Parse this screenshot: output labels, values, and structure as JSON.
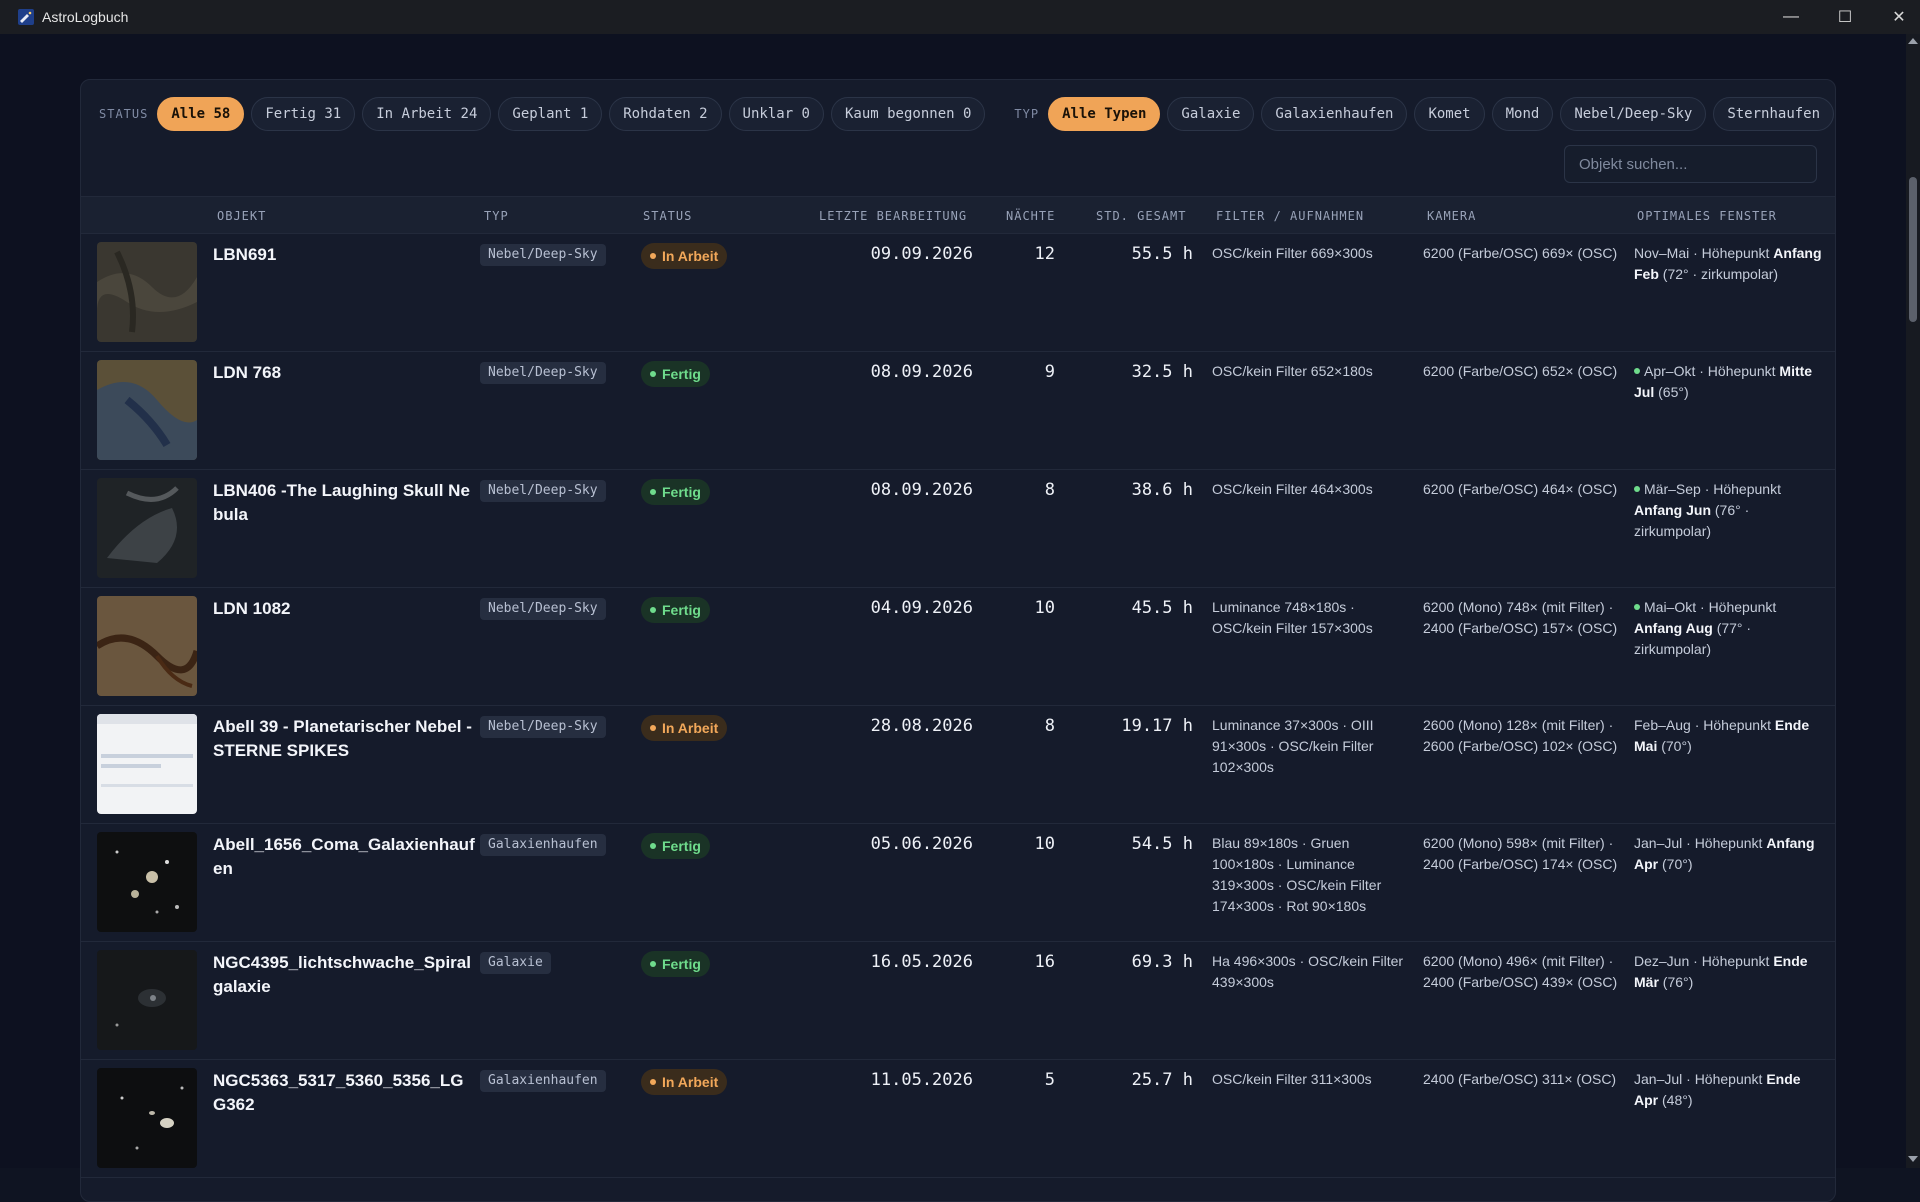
{
  "window": {
    "title": "AstroLogbuch",
    "minimize_glyph": "—",
    "maximize_glyph": "☐",
    "close_glyph": "✕"
  },
  "status_filter": {
    "label": "STATUS",
    "chips": [
      "Alle 58",
      "Fertig 31",
      "In Arbeit 24",
      "Geplant 1",
      "Rohdaten 2",
      "Unklar 0",
      "Kaum begonnen 0"
    ],
    "active": "Alle 58"
  },
  "type_filter": {
    "label": "TYP",
    "chips": [
      "Alle Typen",
      "Galaxie",
      "Galaxienhaufen",
      "Komet",
      "Mond",
      "Nebel/Deep-Sky",
      "Sternhaufen"
    ],
    "active": "Alle Typen"
  },
  "search": {
    "placeholder": "Objekt suchen..."
  },
  "table": {
    "headers": {
      "objekt": "OBJEKT",
      "typ": "TYP",
      "status": "STATUS",
      "letzte": "LETZTE BEARBEITUNG",
      "naechte": "NÄCHTE",
      "std": "STD. GESAMT",
      "filter": "FILTER / AUFNAHMEN",
      "kamera": "KAMERA",
      "fenster": "OPTIMALES FENSTER"
    },
    "rows": [
      {
        "objekt": "LBN691",
        "typ": "Nebel/Deep-Sky",
        "status": "In Arbeit",
        "datum": "09.09.2026",
        "naechte": "12",
        "std": "55.5 h",
        "filter": "OSC/kein Filter 669×300s",
        "kamera": "6200 (Farbe/OSC) 669× (OSC)",
        "fenster_pre": "Nov–Mai · Höhepunkt ",
        "fenster_bold": "Anfang Feb",
        "fenster_post": " (72° · zirkumpolar)",
        "fenster_dot": false
      },
      {
        "objekt": "LDN 768",
        "typ": "Nebel/Deep-Sky",
        "status": "Fertig",
        "datum": "08.09.2026",
        "naechte": "9",
        "std": "32.5 h",
        "filter": "OSC/kein Filter 652×180s",
        "kamera": "6200 (Farbe/OSC) 652× (OSC)",
        "fenster_pre": "Apr–Okt · Höhepunkt ",
        "fenster_bold": "Mitte Jul",
        "fenster_post": " (65°)",
        "fenster_dot": true
      },
      {
        "objekt": "LBN406 -The Laughing Skull Nebula",
        "typ": "Nebel/Deep-Sky",
        "status": "Fertig",
        "datum": "08.09.2026",
        "naechte": "8",
        "std": "38.6 h",
        "filter": "OSC/kein Filter 464×300s",
        "kamera": "6200 (Farbe/OSC) 464× (OSC)",
        "fenster_pre": "Mär–Sep · Höhepunkt ",
        "fenster_bold": "Anfang Jun",
        "fenster_post": " (76° · zirkumpolar)",
        "fenster_dot": true
      },
      {
        "objekt": "LDN 1082",
        "typ": "Nebel/Deep-Sky",
        "status": "Fertig",
        "datum": "04.09.2026",
        "naechte": "10",
        "std": "45.5 h",
        "filter": "Luminance 748×180s · OSC/kein Filter 157×300s",
        "kamera": "6200 (Mono) 748× (mit Filter) · 2400 (Farbe/OSC) 157× (OSC)",
        "fenster_pre": "Mai–Okt · Höhepunkt ",
        "fenster_bold": "Anfang Aug",
        "fenster_post": " (77° · zirkumpolar)",
        "fenster_dot": true
      },
      {
        "objekt": "Abell 39 - Planetarischer Nebel - STERNE SPIKES",
        "typ": "Nebel/Deep-Sky",
        "status": "In Arbeit",
        "datum": "28.08.2026",
        "naechte": "8",
        "std": "19.17 h",
        "filter": "Luminance 37×300s · OIII 91×300s · OSC/kein Filter 102×300s",
        "kamera": "2600 (Mono) 128× (mit Filter) · 2600 (Farbe/OSC) 102× (OSC)",
        "fenster_pre": "Feb–Aug · Höhepunkt ",
        "fenster_bold": "Ende Mai",
        "fenster_post": " (70°)",
        "fenster_dot": false
      },
      {
        "objekt": "Abell_1656_Coma_Galaxienhaufen",
        "typ": "Galaxienhaufen",
        "status": "Fertig",
        "datum": "05.06.2026",
        "naechte": "10",
        "std": "54.5 h",
        "filter": "Blau 89×180s · Gruen 100×180s · Luminance 319×300s · OSC/kein Filter 174×300s · Rot 90×180s",
        "kamera": "6200 (Mono) 598× (mit Filter) · 2400 (Farbe/OSC) 174× (OSC)",
        "fenster_pre": "Jan–Jul · Höhepunkt ",
        "fenster_bold": "Anfang Apr",
        "fenster_post": " (70°)",
        "fenster_dot": false
      },
      {
        "objekt": "NGC4395_lichtschwache_Spiralgalaxie",
        "typ": "Galaxie",
        "status": "Fertig",
        "datum": "16.05.2026",
        "naechte": "16",
        "std": "69.3 h",
        "filter": "Ha 496×300s · OSC/kein Filter 439×300s",
        "kamera": "6200 (Mono) 496× (mit Filter) · 2400 (Farbe/OSC) 439× (OSC)",
        "fenster_pre": "Dez–Jun · Höhepunkt ",
        "fenster_bold": "Ende Mär",
        "fenster_post": " (76°)",
        "fenster_dot": false
      },
      {
        "objekt": "NGC5363_5317_5360_5356_LGG362",
        "typ": "Galaxienhaufen",
        "status": "In Arbeit",
        "datum": "11.05.2026",
        "naechte": "5",
        "std": "25.7 h",
        "filter": "OSC/kein Filter 311×300s",
        "kamera": "2400 (Farbe/OSC) 311× (OSC)",
        "fenster_pre": "Jan–Jul · Höhepunkt ",
        "fenster_bold": "Ende Apr",
        "fenster_post": " (48°)",
        "fenster_dot": false
      }
    ]
  },
  "colors": {
    "accent": "#f0a457",
    "status_in_arbeit": "#f2a85a",
    "status_fertig": "#6fdc8c"
  }
}
